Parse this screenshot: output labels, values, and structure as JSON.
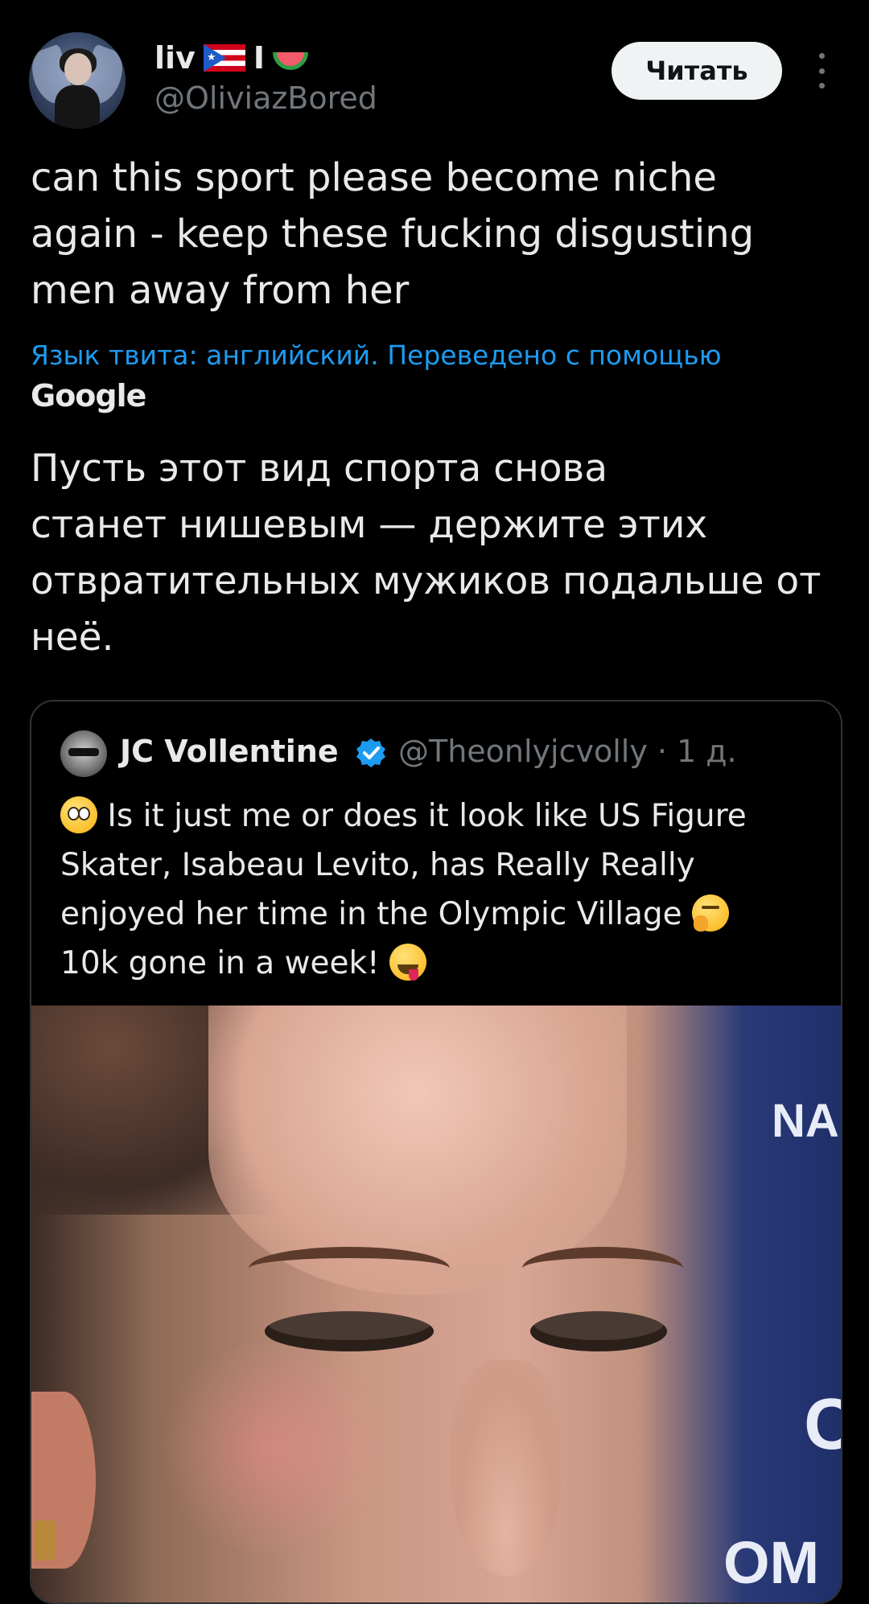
{
  "header": {
    "display_name": "liv",
    "name_separator": "I",
    "handle": "@OliviazBored",
    "follow_label": "Читать",
    "flag_icon": "puerto-rico-flag",
    "melon_icon": "watermelon-emoji"
  },
  "tweet": {
    "text_lines": [
      "can this sport please become niche",
      "again - keep these fucking disgusting",
      "men away from her"
    ],
    "translation_note": "Язык твита: английский. Переведено с помощью",
    "translation_provider": "Google",
    "translated_lines": [
      "Пусть этот вид спорта снова",
      "станет нишевым — держите этих",
      "отвратительных мужиков подальше от",
      "неё."
    ]
  },
  "quote": {
    "name": "JC Vollentine",
    "handle": "@Theonlyjcvolly",
    "dot": "·",
    "time": "1 д.",
    "verified_color": "#1d9bf0",
    "line1": "Is it just me or does it look like US Figure",
    "line2": "Skater, Isabeau Levito, has Really Really",
    "line3": "enjoyed her time in the Olympic Village",
    "line4": "10k gone in a week!",
    "media_text_1": "NA",
    "media_text_2": "C",
    "media_text_3": "OM"
  }
}
